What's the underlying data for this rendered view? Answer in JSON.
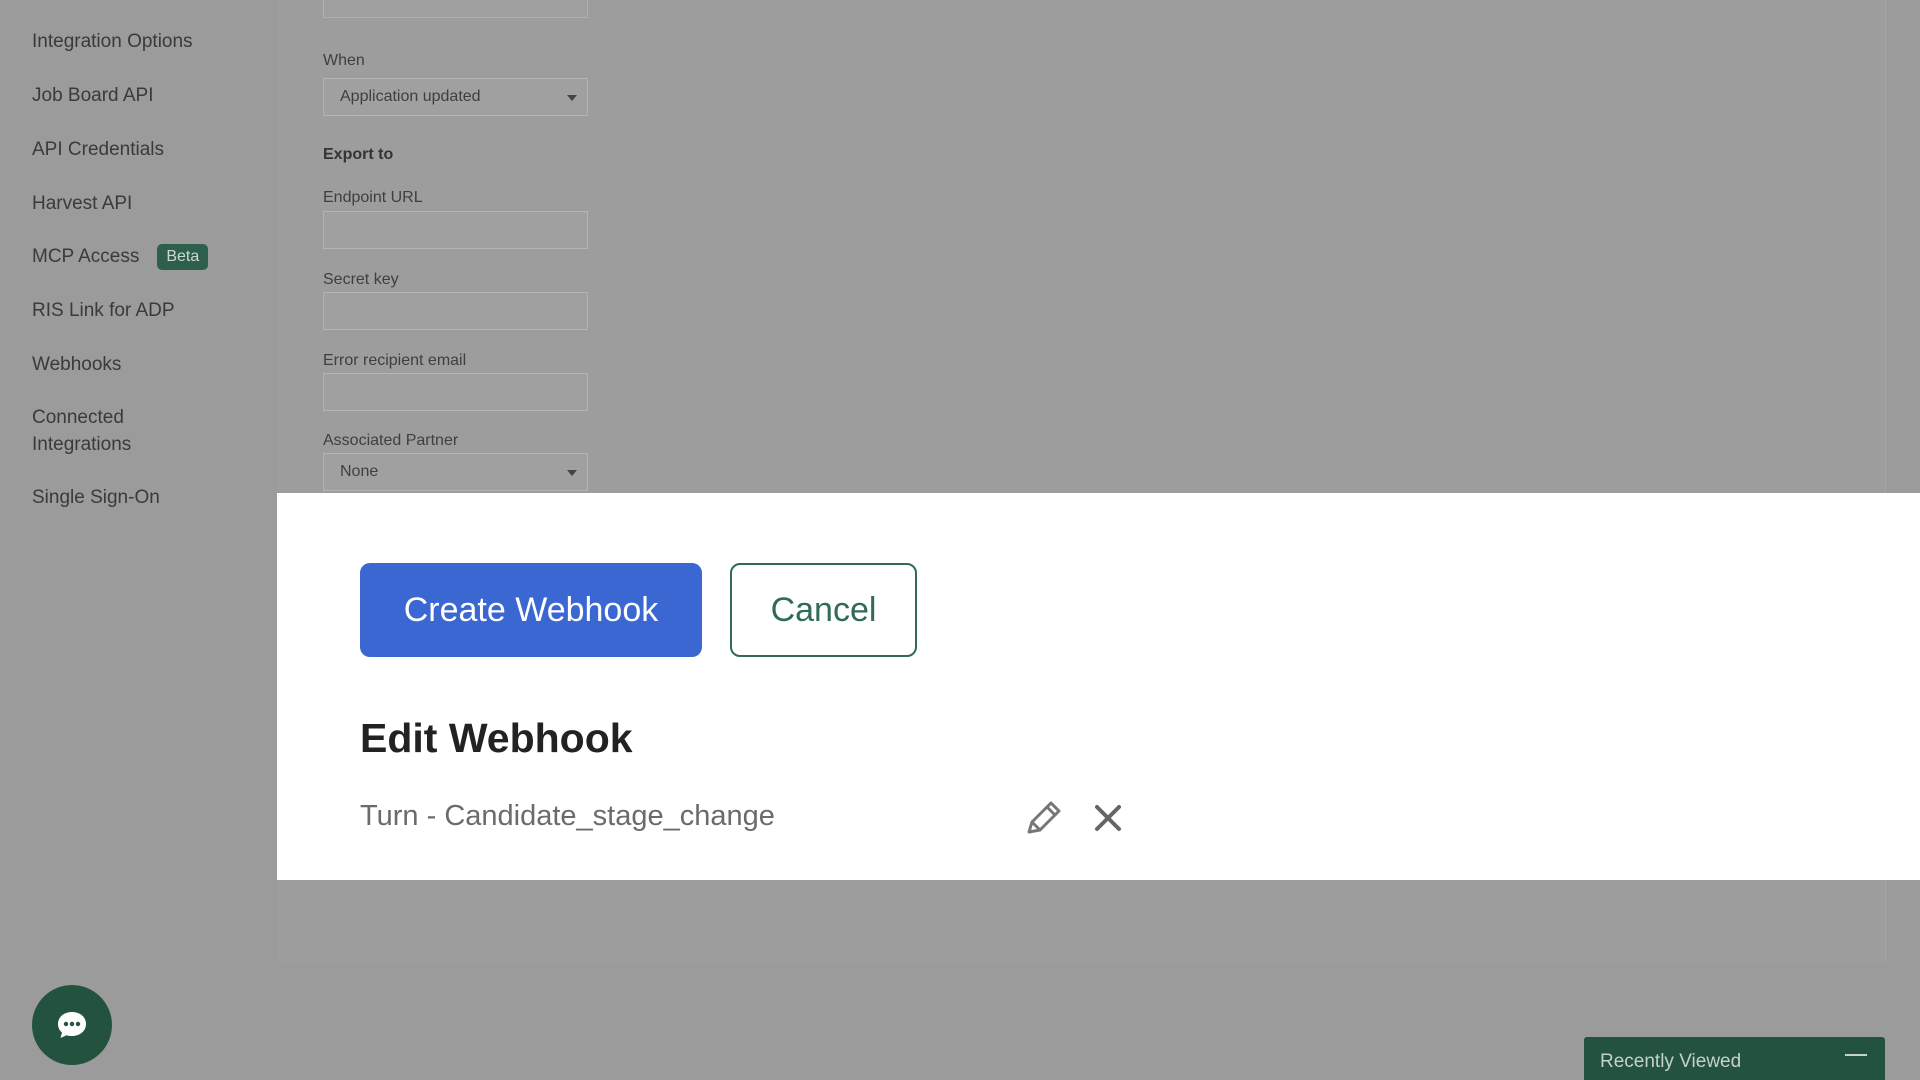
{
  "sidebar": {
    "items": [
      {
        "label": "Integration Options"
      },
      {
        "label": "Job Board API"
      },
      {
        "label": "API Credentials"
      },
      {
        "label": "Harvest API"
      },
      {
        "label": "MCP Access",
        "badge": "Beta"
      },
      {
        "label": "RIS Link for ADP"
      },
      {
        "label": "Webhooks"
      },
      {
        "label": "Connected Integrations"
      },
      {
        "label": "Single Sign-On"
      }
    ]
  },
  "form": {
    "when_label": "When",
    "when_value": "Application updated",
    "export_heading": "Export to",
    "endpoint_label": "Endpoint URL",
    "endpoint_value": "",
    "secret_label": "Secret key",
    "secret_value": "",
    "error_email_label": "Error recipient email",
    "error_email_value": "",
    "partner_label": "Associated Partner",
    "partner_value": "None"
  },
  "actions": {
    "create_label": "Create Webhook",
    "cancel_label": "Cancel"
  },
  "edit_section": {
    "title": "Edit Webhook",
    "webhooks": [
      {
        "name": "Turn - Candidate_stage_change",
        "edit_icon": "pencil-icon",
        "delete_icon": "close-icon"
      }
    ]
  },
  "footer": {
    "chat_icon": "chat-bubble-icon",
    "recently_viewed_label": "Recently Viewed"
  },
  "colors": {
    "primary_button": "#3b67d3",
    "brand_green": "#23523f",
    "cancel_border": "#2f6b56"
  }
}
